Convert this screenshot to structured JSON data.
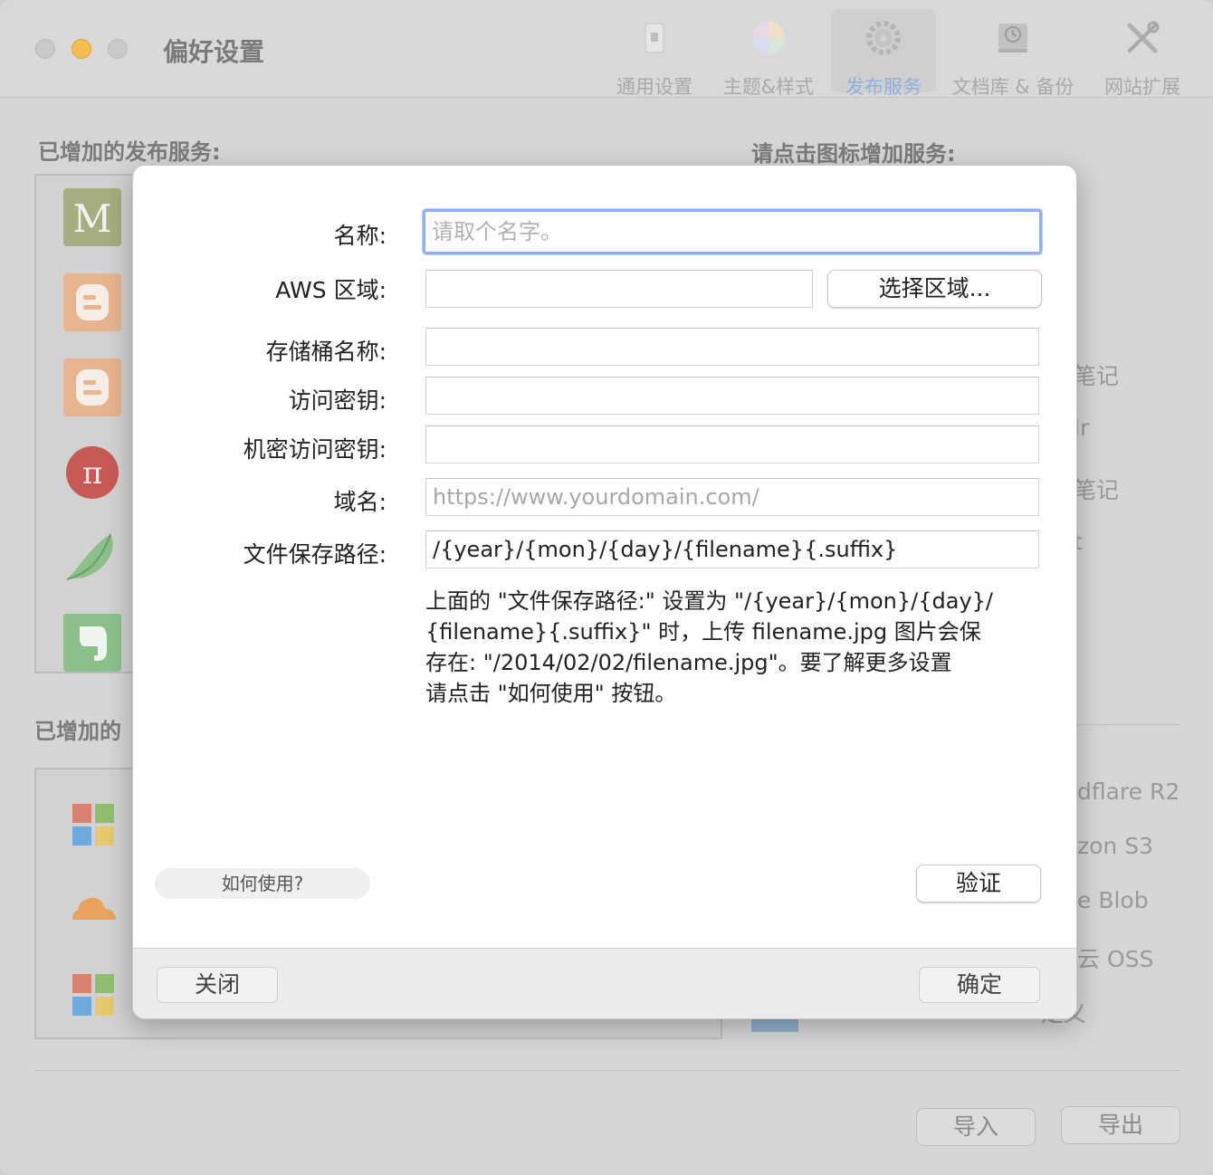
{
  "window": {
    "title": "偏好设置",
    "tabs": [
      {
        "label": "通用设置",
        "icon": "phone-icon"
      },
      {
        "label": "主题&样式",
        "icon": "color-wheel-icon"
      },
      {
        "label": "发布服务",
        "icon": "gear-icon",
        "active": true
      },
      {
        "label": "文档库 & 备份",
        "icon": "time-machine-icon"
      },
      {
        "label": "网站扩展",
        "icon": "tools-icon"
      }
    ]
  },
  "background": {
    "added_publish_label": "已增加的发布服务:",
    "add_service_hint": "请点击图标增加服务:",
    "added_storage_label": "已增加的",
    "services": [
      "medium-icon",
      "blogger-icon",
      "blogger-icon",
      "pi-icon",
      "bird-icon",
      "evernote-icon"
    ],
    "right_fragments": [
      "笔记",
      "lr",
      "笔记",
      "t",
      "dflare R2",
      "zon S3",
      "e Blob",
      "云 OSS",
      "定义"
    ],
    "import_button": "导入",
    "export_button": "导出",
    "colors": {
      "accent": "#8fb0dc",
      "traffic_yellow": "#f5be4f"
    }
  },
  "dialog": {
    "fields": {
      "name": {
        "label": "名称:",
        "placeholder": "请取个名字。",
        "value": ""
      },
      "region": {
        "label": "AWS 区域:",
        "value": ""
      },
      "bucket": {
        "label": "存储桶名称:",
        "value": ""
      },
      "access_key": {
        "label": "访问密钥:",
        "value": ""
      },
      "secret_key": {
        "label": "机密访问密钥:",
        "value": ""
      },
      "domain": {
        "label": "域名:",
        "placeholder": "https://www.yourdomain.com/",
        "value": ""
      },
      "path": {
        "label": "文件保存路径:",
        "value": "/{year}/{mon}/{day}/{filename}{.suffix}"
      }
    },
    "select_region_button": "选择区域...",
    "help_text_lines": [
      "上面的 \"文件保存路径:\" 设置为 \"/{year}/{mon}/{day}/",
      "{filename}{.suffix}\" 时，上传 filename.jpg 图片会保",
      "存在: \"/2014/02/02/filename.jpg\"。要了解更多设置",
      "请点击 \"如何使用\" 按钮。"
    ],
    "howto_button": "如何使用?",
    "verify_button": "验证",
    "close_button": "关闭",
    "ok_button": "确定"
  }
}
